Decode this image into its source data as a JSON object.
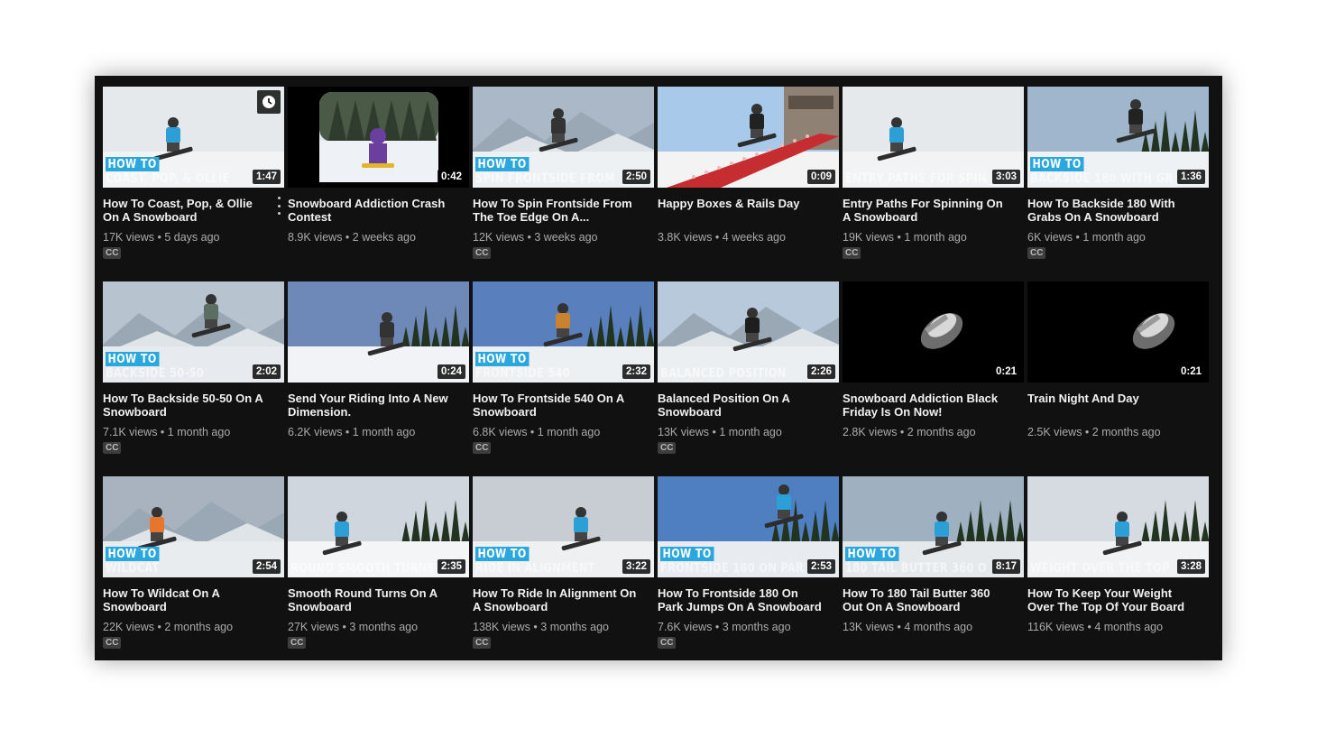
{
  "colors": {
    "panel_bg": "#111111",
    "howto_badge": "#2aa7dd",
    "title_text": "#f1f1f1",
    "meta_text": "#aaaaaa"
  },
  "videos": [
    {
      "title": "How To Coast, Pop, & Ollie On A Snowboard",
      "views": "17K views",
      "age": "5 days ago",
      "duration": "1:47",
      "cc": "CC",
      "howto": "HOW TO",
      "overlay": "COAST, POP, & OLLIE",
      "watch_later_icon": "clock-icon",
      "menu_icon": "more-vert-icon"
    },
    {
      "title": "Snowboard Addiction Crash Contest",
      "views": "8.9K views",
      "age": "2 weeks ago",
      "duration": "0:42",
      "cc": "",
      "howto": "",
      "overlay": ""
    },
    {
      "title": "How To Spin Frontside From The Toe Edge On A...",
      "views": "12K views",
      "age": "3 weeks ago",
      "duration": "2:50",
      "cc": "CC",
      "howto": "HOW TO",
      "overlay": "SPIN FRONTSIDE FROM THE TOE"
    },
    {
      "title": "Happy Boxes & Rails Day",
      "views": "3.8K views",
      "age": "4 weeks ago",
      "duration": "0:09",
      "cc": "",
      "howto": "",
      "overlay": ""
    },
    {
      "title": "Entry Paths For Spinning On A Snowboard",
      "views": "19K views",
      "age": "1 month ago",
      "duration": "3:03",
      "cc": "CC",
      "howto": "",
      "overlay": "ENTRY PATHS FOR SPINNING"
    },
    {
      "title": "How To Backside 180 With Grabs On A Snowboard",
      "views": "6K views",
      "age": "1 month ago",
      "duration": "1:36",
      "cc": "CC",
      "howto": "HOW TO",
      "overlay": "BACKSIDE 180 WITH GRABS"
    },
    {
      "title": "How To Backside 50-50 On A Snowboard",
      "views": "7.1K views",
      "age": "1 month ago",
      "duration": "2:02",
      "cc": "CC",
      "howto": "HOW TO",
      "overlay": "BACKSIDE 50-50"
    },
    {
      "title": "Send Your Riding Into A New Dimension.",
      "views": "6.2K views",
      "age": "1 month ago",
      "duration": "0:24",
      "cc": "",
      "howto": "",
      "overlay": ""
    },
    {
      "title": "How To Frontside 540 On A Snowboard",
      "views": "6.8K views",
      "age": "1 month ago",
      "duration": "2:32",
      "cc": "CC",
      "howto": "HOW TO",
      "overlay": "FRONTSIDE 540"
    },
    {
      "title": "Balanced Position On A Snowboard",
      "views": "13K views",
      "age": "1 month ago",
      "duration": "2:26",
      "cc": "CC",
      "howto": "",
      "overlay": "BALANCED POSITION"
    },
    {
      "title": "Snowboard Addiction Black Friday Is On Now!",
      "views": "2.8K views",
      "age": "2 months ago",
      "duration": "0:21",
      "cc": "",
      "howto": "",
      "overlay": ""
    },
    {
      "title": "Train Night And Day",
      "views": "2.5K views",
      "age": "2 months ago",
      "duration": "0:21",
      "cc": "",
      "howto": "",
      "overlay": ""
    },
    {
      "title": "How To Wildcat On A Snowboard",
      "views": "22K views",
      "age": "2 months ago",
      "duration": "2:54",
      "cc": "CC",
      "howto": "HOW TO",
      "overlay": "WILDCAT"
    },
    {
      "title": "Smooth Round Turns On A Snowboard",
      "views": "27K views",
      "age": "3 months ago",
      "duration": "2:35",
      "cc": "CC",
      "howto": "",
      "overlay": "ROUND SMOOTH TURNS"
    },
    {
      "title": "How To Ride In Alignment On A Snowboard",
      "views": "138K views",
      "age": "3 months ago",
      "duration": "3:22",
      "cc": "CC",
      "howto": "HOW TO",
      "overlay": "RIDE IN ALIGNMENT"
    },
    {
      "title": "How To Frontside 180 On Park Jumps On A Snowboard",
      "views": "7.6K views",
      "age": "3 months ago",
      "duration": "2:53",
      "cc": "CC",
      "howto": "HOW TO",
      "overlay": "FRONTSIDE 180 ON PARK JUMPS"
    },
    {
      "title": "How To 180 Tail Butter 360 Out On A Snowboard",
      "views": "13K views",
      "age": "4 months ago",
      "duration": "8:17",
      "cc": "",
      "howto": "HOW TO",
      "overlay": "180 TAIL BUTTER 360 OUT"
    },
    {
      "title": "How To Keep Your Weight Over The Top Of Your Board",
      "views": "116K views",
      "age": "4 months ago",
      "duration": "3:28",
      "cc": "",
      "howto": "",
      "overlay": "WEIGHT OVER THE TOP OF YOUR BOARD"
    }
  ]
}
